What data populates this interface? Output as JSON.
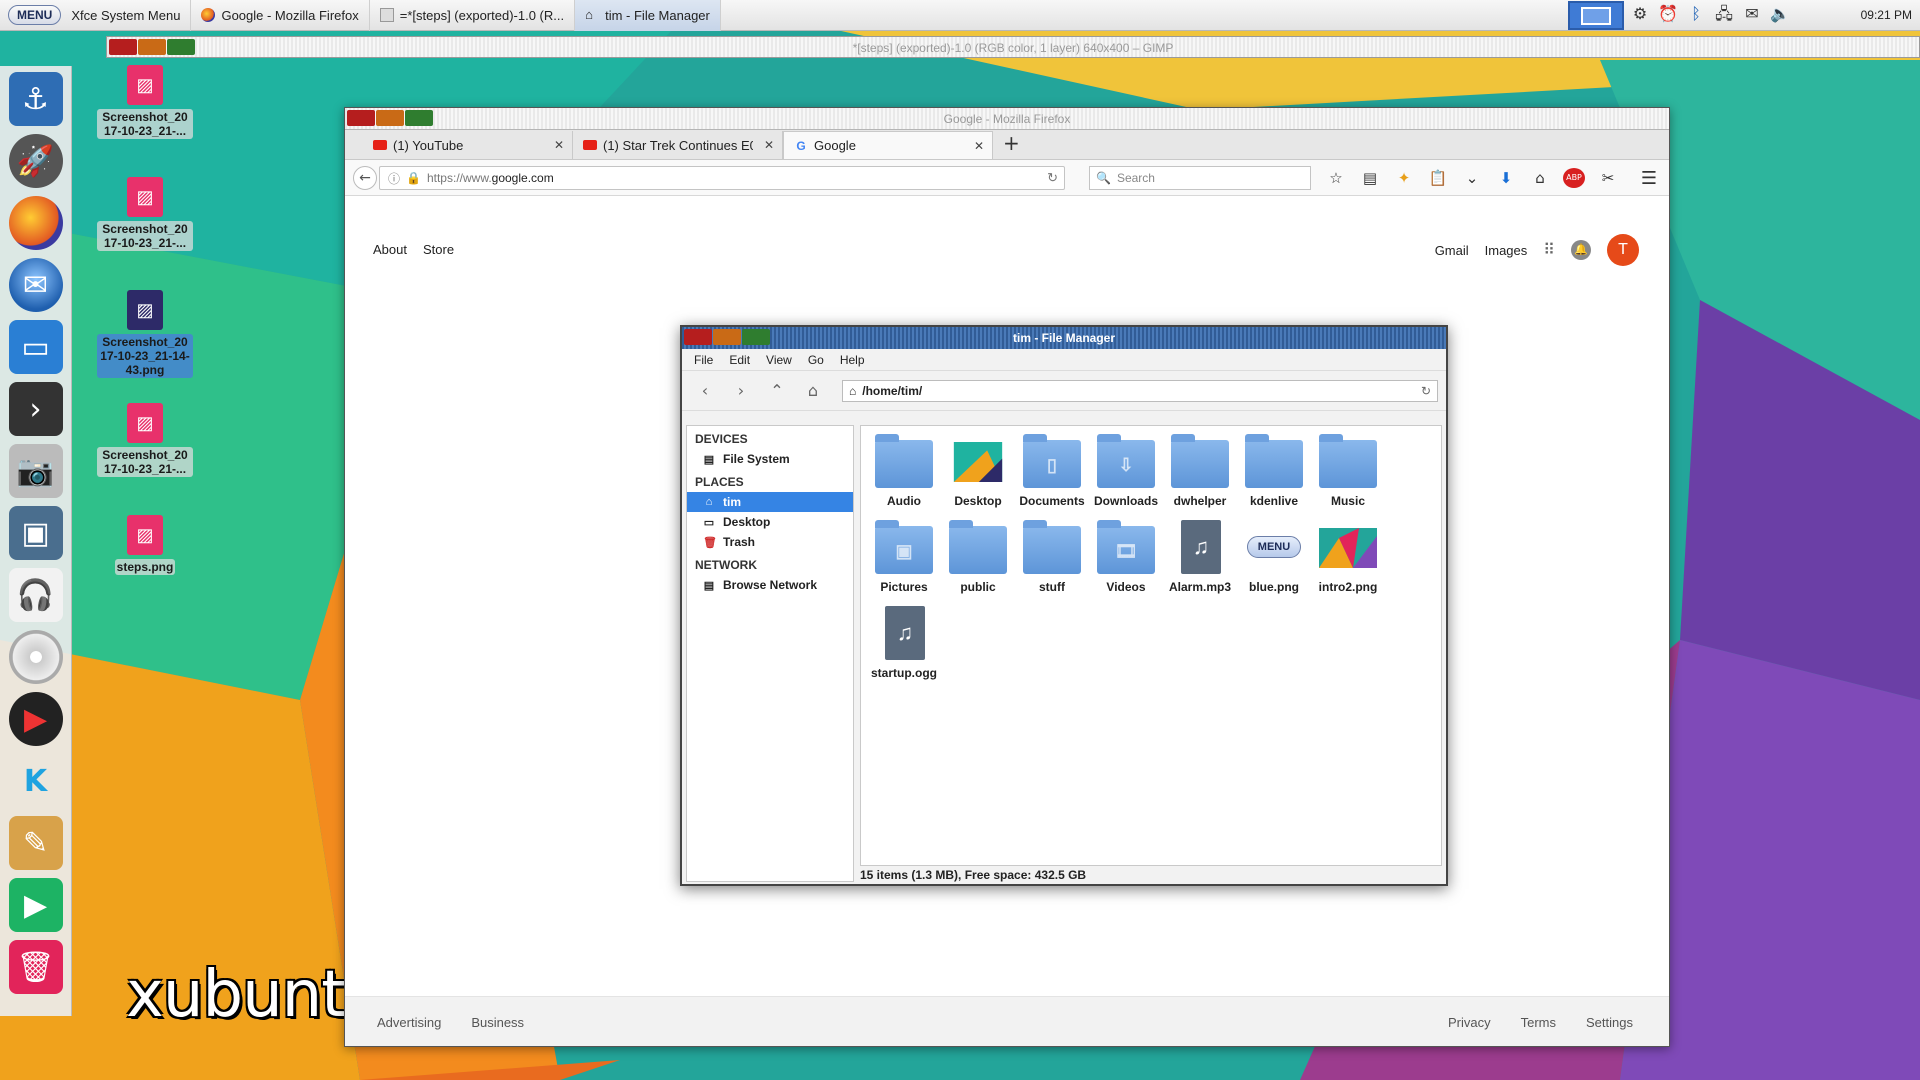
{
  "top_panel": {
    "menu_label": "MENU",
    "tasks": [
      {
        "label": "Xfce System Menu",
        "icon": "menu-icon"
      },
      {
        "label": "Google - Mozilla Firefox",
        "icon": "firefox-icon"
      },
      {
        "label": "=*[steps] (exported)-1.0 (R...",
        "icon": "gimp-icon"
      },
      {
        "label": "tim - File Manager",
        "icon": "home-folder-icon"
      }
    ],
    "clock": "09:21 PM"
  },
  "gimp_window": {
    "title": "*[steps] (exported)-1.0 (RGB color, 1 layer) 640x400 – GIMP"
  },
  "desktop_icons": [
    {
      "label": "Screenshot_2017-10-23_21-..."
    },
    {
      "label": "Screenshot_2017-10-23_21-..."
    },
    {
      "label": "Screenshot_2017-10-23_21-14-43.png"
    },
    {
      "label": "Screenshot_2017-10-23_21-..."
    },
    {
      "label": "steps.png"
    }
  ],
  "wallpaper_logo": "xubunt",
  "firefox": {
    "title": "Google - Mozilla Firefox",
    "tabs": [
      {
        "label": "(1) YouTube"
      },
      {
        "label": "(1) Star Trek Continues E0"
      },
      {
        "label": "Google"
      }
    ],
    "url_scheme": "https://www.",
    "url_host": "google.com",
    "search_placeholder": "Search",
    "google": {
      "top_left": [
        "About",
        "Store"
      ],
      "top_right": [
        "Gmail",
        "Images"
      ],
      "avatar_letter": "T",
      "footer_left": [
        "Advertising",
        "Business"
      ],
      "footer_right": [
        "Privacy",
        "Terms",
        "Settings"
      ]
    }
  },
  "file_manager": {
    "title": "tim - File Manager",
    "menus": [
      "File",
      "Edit",
      "View",
      "Go",
      "Help"
    ],
    "path": "/home/tim/",
    "sidebar": {
      "devices_heading": "DEVICES",
      "file_system": "File System",
      "places_heading": "PLACES",
      "tim": "tim",
      "desktop": "Desktop",
      "trash": "Trash",
      "network_heading": "NETWORK",
      "browse_network": "Browse Network"
    },
    "items": [
      {
        "label": "Audio",
        "kind": "folder"
      },
      {
        "label": "Desktop",
        "kind": "desktop-thumb"
      },
      {
        "label": "Documents",
        "kind": "folder-doc"
      },
      {
        "label": "Downloads",
        "kind": "folder-download"
      },
      {
        "label": "dwhelper",
        "kind": "folder"
      },
      {
        "label": "kdenlive",
        "kind": "folder"
      },
      {
        "label": "Music",
        "kind": "folder"
      },
      {
        "label": "Pictures",
        "kind": "folder-pictures"
      },
      {
        "label": "public",
        "kind": "folder"
      },
      {
        "label": "stuff",
        "kind": "folder"
      },
      {
        "label": "Videos",
        "kind": "folder-videos"
      },
      {
        "label": "Alarm.mp3",
        "kind": "audio-file"
      },
      {
        "label": "blue.png",
        "kind": "menu-image",
        "image_text": "MENU"
      },
      {
        "label": "intro2.png",
        "kind": "image-thumb"
      },
      {
        "label": "startup.ogg",
        "kind": "audio-file"
      }
    ],
    "status": "15 items (1.3 MB), Free space: 432.5 GB"
  }
}
